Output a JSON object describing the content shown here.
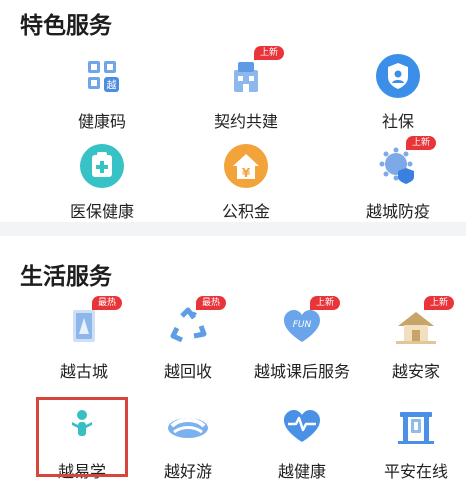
{
  "sections": [
    {
      "title": "特色服务",
      "items": [
        {
          "label": "健康码",
          "icon": "qr-code-icon",
          "badge": ""
        },
        {
          "label": "契约共建",
          "icon": "community-building-icon",
          "badge": "上新"
        },
        {
          "label": "社保",
          "icon": "social-security-shield-icon",
          "badge": ""
        },
        {
          "label": "医保健康",
          "icon": "medical-insurance-icon",
          "badge": ""
        },
        {
          "label": "公积金",
          "icon": "housing-fund-icon",
          "badge": ""
        },
        {
          "label": "越城防疫",
          "icon": "epidemic-prevention-icon",
          "badge": "上新"
        }
      ]
    },
    {
      "title": "生活服务",
      "items": [
        {
          "label": "越古城",
          "icon": "ancient-city-icon",
          "badge": "最热"
        },
        {
          "label": "越回收",
          "icon": "recycle-icon",
          "badge": "最热"
        },
        {
          "label": "越城课后服务",
          "icon": "after-school-fun-icon",
          "badge": "上新"
        },
        {
          "label": "越安家",
          "icon": "home-settle-icon",
          "badge": "上新"
        },
        {
          "label": "越易学",
          "icon": "easy-learning-icon",
          "badge": ""
        },
        {
          "label": "越好游",
          "icon": "travel-icon",
          "badge": ""
        },
        {
          "label": "越健康",
          "icon": "health-heart-icon",
          "badge": ""
        },
        {
          "label": "平安在线",
          "icon": "safety-online-icon",
          "badge": ""
        }
      ]
    }
  ],
  "colors": {
    "badge": "#e9353a",
    "highlight": "#d6463d",
    "primary_blue": "#3b8fe8"
  }
}
